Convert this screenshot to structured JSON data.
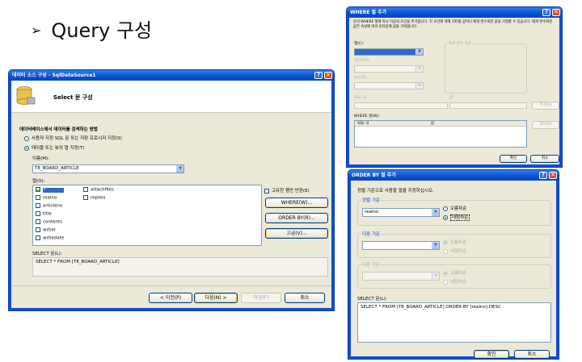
{
  "slide": {
    "arrow": "➢",
    "title": "Query 구성"
  },
  "configure": {
    "title": "데이터 소스 구성 - SqlDataSource1",
    "header": "Select 문 구성",
    "section_label": "데이터베이스에서 데이터를 검색하는 방법",
    "radio_custom": "사용자 지정 SQL 문 또는 저장 프로시저 지정(S)",
    "radio_table": "테이블 또는 뷰의 열 지정(T)",
    "name_label": "이름(M):",
    "table_name": "T8_BOARD_ARTICLE",
    "columns_label": "열(O):",
    "columns_left": [
      "*",
      "realno",
      "articleno",
      "title",
      "contents",
      "writer",
      "writedate"
    ],
    "columns_right": [
      "attachfiles",
      "replies"
    ],
    "unique_label": "고유한 행만 반환(E)",
    "where_button": "WHERE(W)...",
    "orderby_button": "ORDER BY(R)...",
    "advanced_button": "고급(V)...",
    "select_label": "SELECT 문(L):",
    "select_text": "SELECT * FROM [T8_BOARD_ARTICLE]",
    "prev_button": "< 이전(P)",
    "next_button": "다음(N) >",
    "finish_button": "마침(F)",
    "cancel_button": "취소"
  },
  "where": {
    "title": "WHERE 절 추가",
    "description": "문의 WHERE 절에 하나 이상의 조건을 추가합니다. 각 조건에 대해 리터럴 값이나 매개 변수화된 값을 지정할 수 있습니다. 매개 변수화된 값은 속성에 따라 런타임에 값을 가져옵니다.",
    "column_label": "열(C):",
    "operator_label": "연산자(P):",
    "source_label": "소스(S):",
    "param_label": "매개 변수 속성",
    "sql_expr_label": "SQL 식:",
    "value_label": "값:",
    "add_button": "추가(A)",
    "clause_label": "WHERE 절(W):",
    "grid_headers": [
      "SQL 식",
      "값"
    ],
    "remove_button": "제거(R)",
    "ok_button": "확인",
    "cancel_button": "취소"
  },
  "orderby": {
    "title": "ORDER BY 절 추가",
    "description": "정렬 기준으로 사용할 열을 지정하십시오.",
    "sort1_label": "정렬 기준",
    "sort1_value": "realno",
    "asc_label": "오름차순",
    "desc_label": "내림차순",
    "sort2_label": "다음 기준",
    "sort3_label": "다음 기준",
    "select_label": "SELECT 문(L):",
    "select_text": "SELECT * FROM [T8_BOARD_ARTICLE] ORDER BY [realno] DESC",
    "ok_button": "확인",
    "cancel_button": "취소"
  }
}
